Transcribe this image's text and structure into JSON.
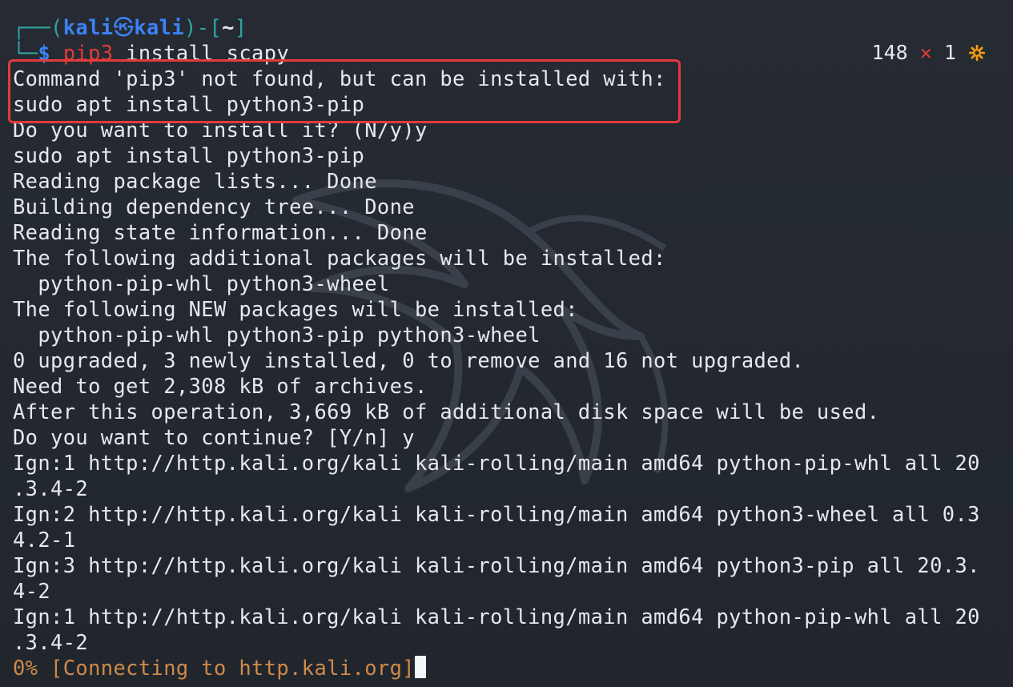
{
  "prompt": {
    "frame_left": "┌──(",
    "user": "kali",
    "separator": "㉿",
    "host": "kali",
    "frame_mid": ")-[",
    "dir": "~",
    "frame_right": "]",
    "second_line_prefix": "└─",
    "dollar": "$",
    "command": "pip3",
    "command_args": " install scapy"
  },
  "status": {
    "count": "148",
    "x": "✕",
    "num": "1",
    "icon": "gear-icon"
  },
  "output_lines": [
    "Command 'pip3' not found, but can be installed with:",
    "sudo apt install python3-pip",
    "Do you want to install it? (N/y)y",
    "sudo apt install python3-pip",
    "Reading package lists... Done",
    "Building dependency tree... Done",
    "Reading state information... Done",
    "The following additional packages will be installed:",
    "  python-pip-whl python3-wheel",
    "The following NEW packages will be installed:",
    "  python-pip-whl python3-pip python3-wheel",
    "0 upgraded, 3 newly installed, 0 to remove and 16 not upgraded.",
    "Need to get 2,308 kB of archives.",
    "After this operation, 3,669 kB of additional disk space will be used.",
    "Do you want to continue? [Y/n] y",
    "Ign:1 http://http.kali.org/kali kali-rolling/main amd64 python-pip-whl all 20",
    ".3.4-2",
    "Ign:2 http://http.kali.org/kali kali-rolling/main amd64 python3-wheel all 0.3",
    "4.2-1",
    "Ign:3 http://http.kali.org/kali kali-rolling/main amd64 python3-pip all 20.3.",
    "4-2",
    "Ign:1 http://http.kali.org/kali kali-rolling/main amd64 python-pip-whl all 20",
    ".3.4-2"
  ],
  "progress_line": "0% [Connecting to http.kali.org]",
  "colors": {
    "background": "#232830",
    "text": "#e6e8ec",
    "prompt_blue": "#3b82f6",
    "frame_teal": "#2fa3a0",
    "error_red": "#e23b3b",
    "progress_orange": "#d08a4a"
  }
}
